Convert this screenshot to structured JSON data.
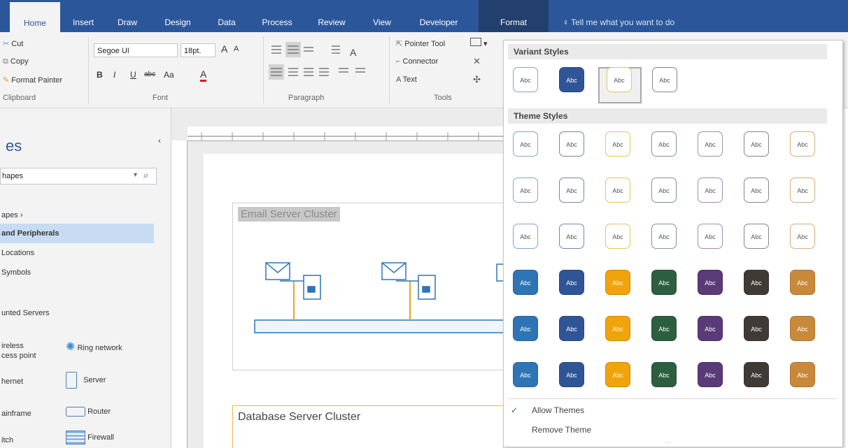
{
  "tabs": [
    "Home",
    "Insert",
    "Draw",
    "Design",
    "Data",
    "Process",
    "Review",
    "View",
    "Developer",
    "Format"
  ],
  "tell_me": "Tell me what you want to do",
  "clipboard": {
    "cut": "Cut",
    "copy": "Copy",
    "format_painter": "Format Painter",
    "group_label": "Clipboard"
  },
  "font": {
    "family": "Segoe UI",
    "size": "18pt.",
    "grow": "A",
    "shrink": "A",
    "bold": "B",
    "italic": "I",
    "underline": "U",
    "strike": "abc",
    "case": "Aa",
    "color_a": "A",
    "group_label": "Font"
  },
  "paragraph": {
    "group_label": "Paragraph"
  },
  "tools": {
    "pointer": "Pointer Tool",
    "connector": "Connector",
    "text": "Text",
    "group_label": "Tools"
  },
  "shapes_pane": {
    "title": "es",
    "search_value": "hapes",
    "items": [
      "apes",
      "and Peripherals",
      "Locations",
      "Symbols",
      "unted Servers"
    ],
    "stencils": [
      {
        "left": "ireless",
        "left2": "cess point",
        "right": "Ring network"
      },
      {
        "left": "hernet",
        "right": "Server"
      },
      {
        "left": "ainframe",
        "right": "Router"
      },
      {
        "left": "itch",
        "right": "Firewall"
      }
    ]
  },
  "canvas": {
    "container1_title": "Email Server Cluster",
    "container2_title": "Database Server Cluster"
  },
  "gallery": {
    "variant_header": "Variant Styles",
    "theme_header": "Theme Styles",
    "swatch_text": "Abc",
    "allow_themes": "Allow Themes",
    "remove_theme": "Remove Theme",
    "theme_colors": [
      "#2e75b6",
      "#2f5597",
      "#f0a30a",
      "#2c5f3f",
      "#5b3a78",
      "#403a35",
      "#c8893a"
    ],
    "outline_colors": [
      "#7fa7cf",
      "#6f87b0",
      "#e8c25c",
      "#7f9886",
      "#9f8cb3",
      "#8a857f",
      "#d9aa78"
    ],
    "variant_fill_colors": [
      "#2f5597"
    ],
    "selected_variant": 3
  }
}
